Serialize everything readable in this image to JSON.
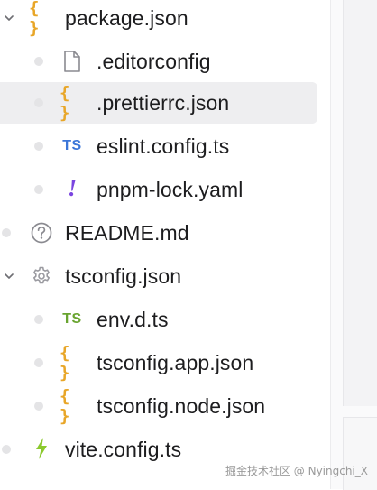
{
  "file_tree": {
    "items": [
      {
        "label": "package.json",
        "icon": "json-braces-icon",
        "type": "folder-expanded"
      },
      {
        "label": ".editorconfig",
        "icon": "file-icon",
        "type": "file"
      },
      {
        "label": ".prettierrc.json",
        "icon": "json-braces-icon",
        "type": "file",
        "selected": true
      },
      {
        "label": "eslint.config.ts",
        "icon": "typescript-icon",
        "type": "file"
      },
      {
        "label": "pnpm-lock.yaml",
        "icon": "exclamation-icon",
        "type": "file"
      },
      {
        "label": "README.md",
        "icon": "question-circle-icon",
        "type": "file"
      },
      {
        "label": "tsconfig.json",
        "icon": "gear-icon",
        "type": "folder-expanded"
      },
      {
        "label": "env.d.ts",
        "icon": "typescript-icon",
        "type": "file"
      },
      {
        "label": "tsconfig.app.json",
        "icon": "json-braces-icon",
        "type": "file"
      },
      {
        "label": "tsconfig.node.json",
        "icon": "json-braces-icon",
        "type": "file"
      },
      {
        "label": "vite.config.ts",
        "icon": "lightning-icon",
        "type": "file"
      }
    ],
    "json_glyph": "{ }",
    "ts_glyph": "TS",
    "yaml_glyph": "!"
  },
  "colors": {
    "json": "#e8a628",
    "ts_blue": "#3b76d8",
    "ts_green": "#69a430",
    "yaml": "#7a45e0",
    "vite": "#8bc92d",
    "selected_bg": "#eeeef0"
  },
  "watermark": "掘金技术社区 @ Nyingchi_X"
}
